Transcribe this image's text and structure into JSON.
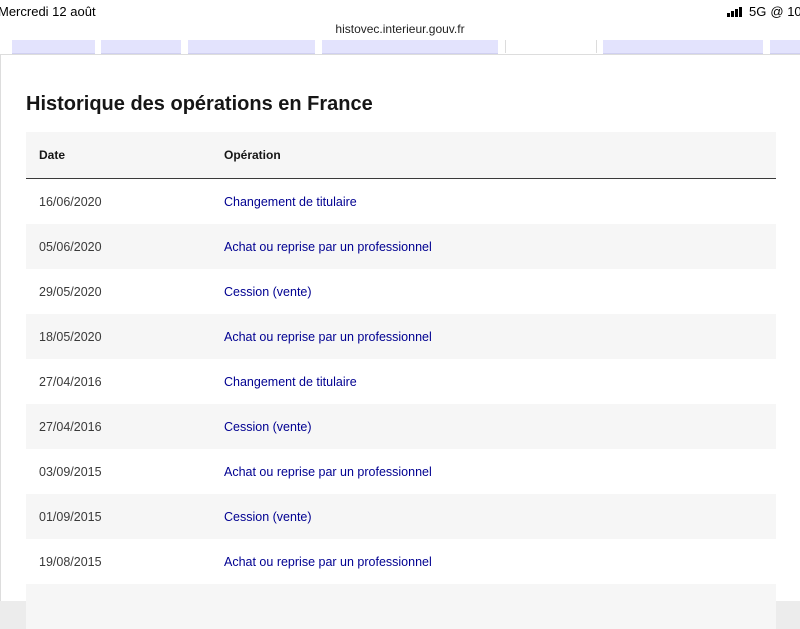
{
  "status_bar": {
    "time": "Mercredi 12 août",
    "network": "5G",
    "battery_partial": "@ 10("
  },
  "browser": {
    "url": "histovec.interieur.gouv.fr"
  },
  "section": {
    "title": "Historique des opérations en France"
  },
  "table": {
    "headers": {
      "date": "Date",
      "operation": "Opération"
    },
    "rows": [
      {
        "date": "16/06/2020",
        "operation": "Changement de titulaire"
      },
      {
        "date": "05/06/2020",
        "operation": "Achat ou reprise par un professionnel"
      },
      {
        "date": "29/05/2020",
        "operation": "Cession (vente)"
      },
      {
        "date": "18/05/2020",
        "operation": "Achat ou reprise par un professionnel"
      },
      {
        "date": "27/04/2016",
        "operation": "Changement de titulaire"
      },
      {
        "date": "27/04/2016",
        "operation": "Cession (vente)"
      },
      {
        "date": "03/09/2015",
        "operation": "Achat ou reprise par un professionnel"
      },
      {
        "date": "01/09/2015",
        "operation": "Cession (vente)"
      },
      {
        "date": "19/08/2015",
        "operation": "Achat ou reprise par un professionnel"
      },
      {
        "date": "",
        "operation": ""
      }
    ]
  }
}
